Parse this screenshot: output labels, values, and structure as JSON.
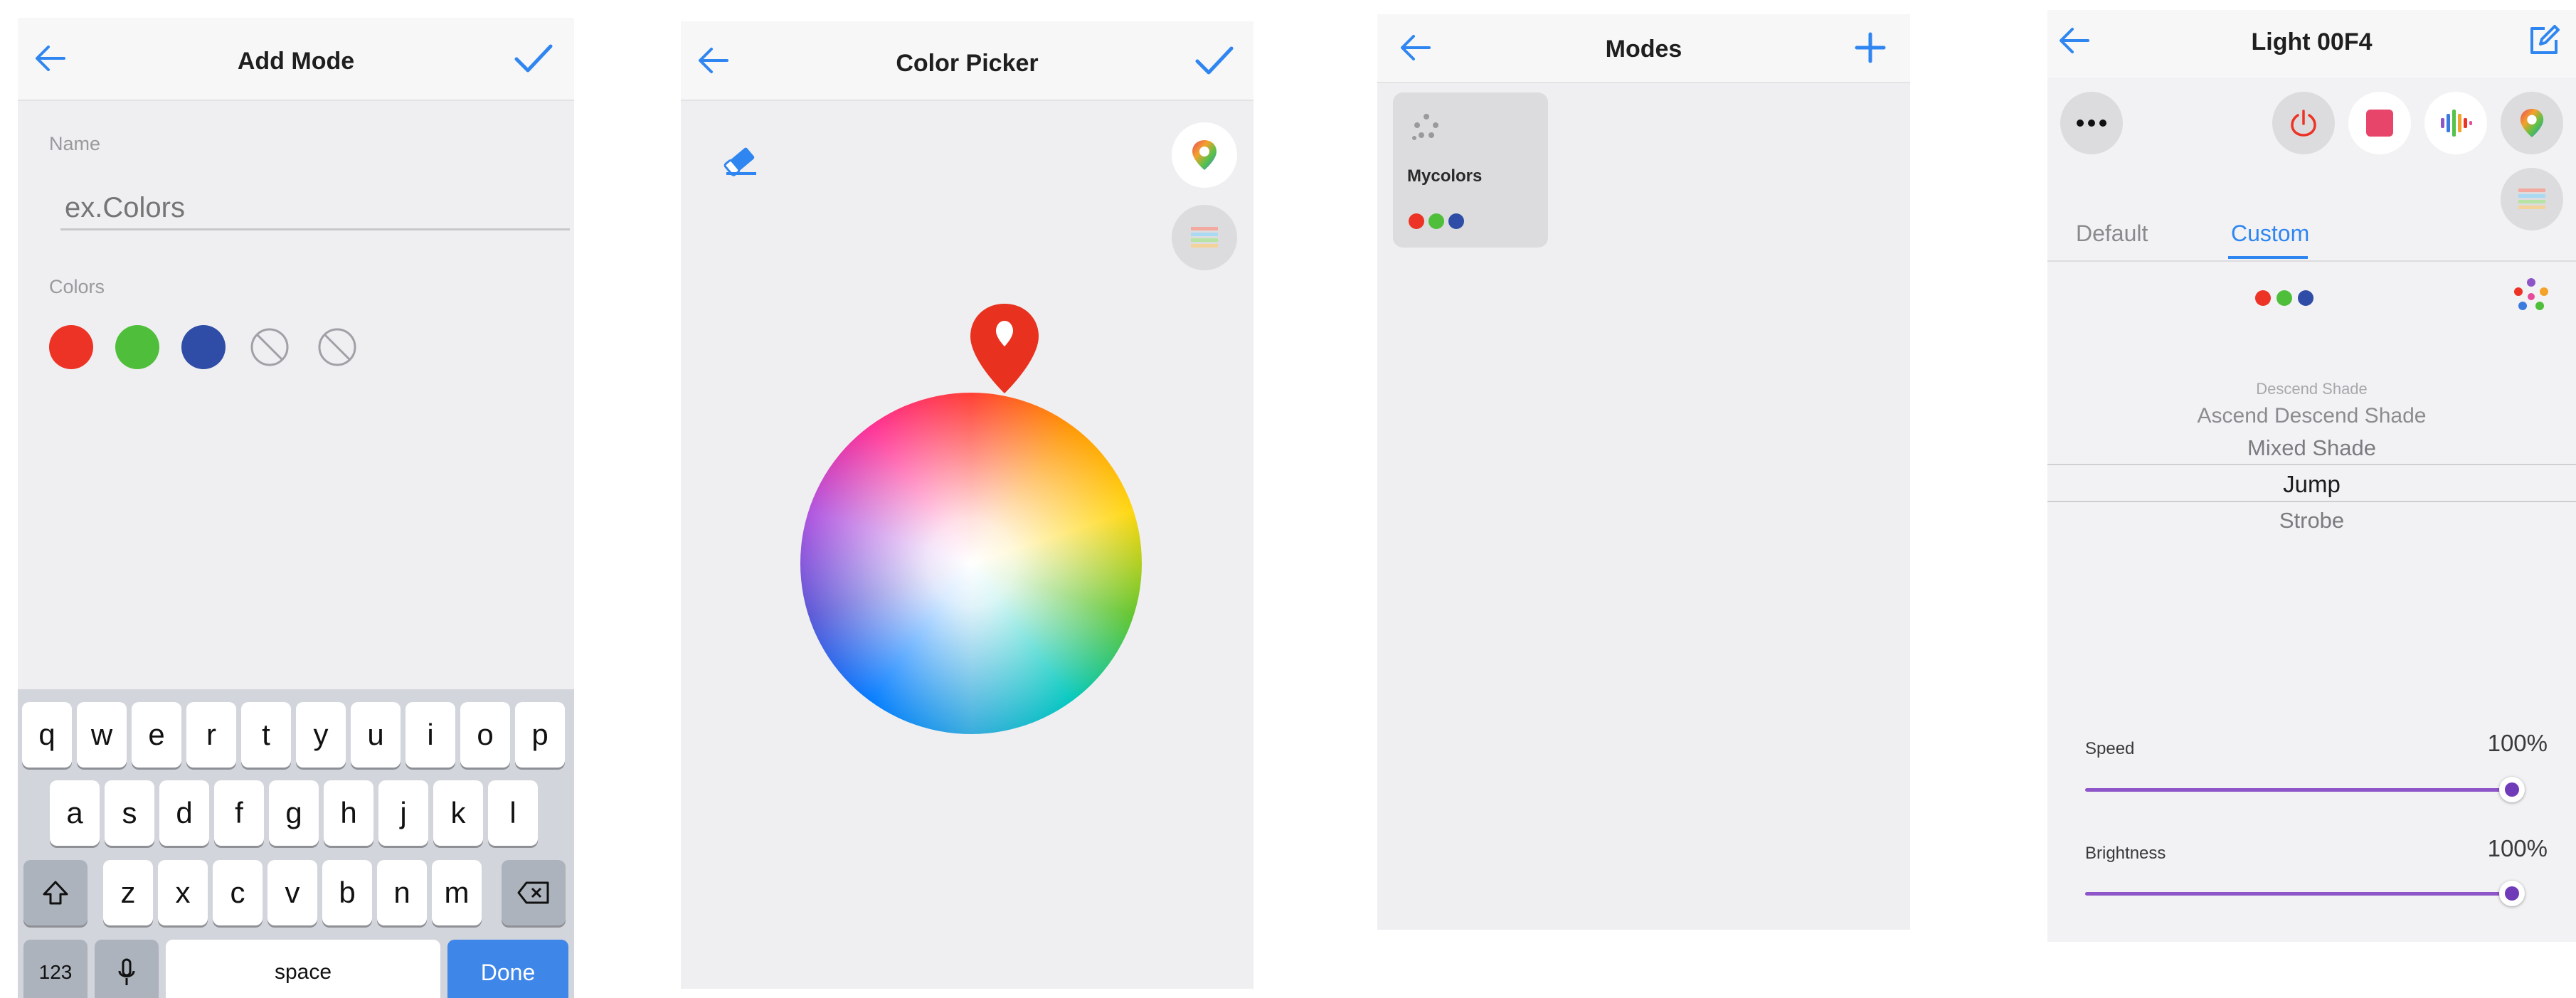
{
  "colors": {
    "accent": "#2f86f0",
    "red": "#ec3325",
    "green": "#4fbf3b",
    "blue": "#2f4da6",
    "purple": "#6f3bb8",
    "pin_red": "#e8321f"
  },
  "add_mode": {
    "title": "Add Mode",
    "name_label": "Name",
    "name_placeholder": "ex.Colors",
    "colors_label": "Colors",
    "swatches": [
      "red",
      "green",
      "blue",
      "empty",
      "empty"
    ],
    "keyboard": {
      "row1": [
        "q",
        "w",
        "e",
        "r",
        "t",
        "y",
        "u",
        "i",
        "o",
        "p"
      ],
      "row2": [
        "a",
        "s",
        "d",
        "f",
        "g",
        "h",
        "j",
        "k",
        "l"
      ],
      "row3": [
        "z",
        "x",
        "c",
        "v",
        "b",
        "n",
        "m"
      ],
      "numbers_key": "123",
      "space_key": "space",
      "done_key": "Done"
    }
  },
  "color_picker": {
    "title": "Color Picker"
  },
  "modes": {
    "title": "Modes",
    "items": [
      {
        "label": "Mycolors"
      }
    ]
  },
  "light": {
    "title": "Light 00F4",
    "tabs": [
      "Default",
      "Custom"
    ],
    "active_tab": "Custom",
    "picker_items": [
      "Descend Shade",
      "Ascend Descend Shade",
      "Mixed Shade",
      "Jump",
      "Strobe"
    ],
    "selected_item": "Jump",
    "speed_label": "Speed",
    "speed_value": "100%",
    "speed_level": 1.0,
    "brightness_label": "Brightness",
    "brightness_value": "100%",
    "brightness_level": 1.0
  }
}
